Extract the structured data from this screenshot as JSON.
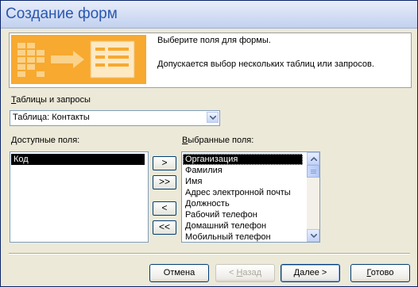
{
  "window": {
    "title": "Создание форм"
  },
  "header": {
    "line1": "Выберите поля для формы.",
    "line2": "Допускается выбор нескольких таблиц или запросов."
  },
  "tables": {
    "label_prefix": "Т",
    "label_rest": "аблицы и запросы",
    "selected": "Таблица: Контакты"
  },
  "available": {
    "label": "Доступные поля:",
    "items": [
      "Код"
    ]
  },
  "selected_fields": {
    "label_prefix": "В",
    "label_rest": "ыбранные поля:",
    "items": [
      "Организация",
      "Фамилия",
      "Имя",
      "Адрес электронной почты",
      "Должность",
      "Рабочий телефон",
      "Домашний телефон",
      "Мобильный телефон"
    ]
  },
  "move_buttons": {
    "add": ">",
    "add_all": ">>",
    "remove": "<",
    "remove_all": "<<"
  },
  "buttons": {
    "cancel": "Отмена",
    "back_prefix": "< ",
    "back_key": "Н",
    "back_rest": "азад",
    "next_key": "Д",
    "next_rest": "алее >",
    "finish_key": "Г",
    "finish_rest": "отово"
  },
  "colors": {
    "title": "#2a58b0",
    "selection": "#000000",
    "header_image": "#f7a930"
  }
}
